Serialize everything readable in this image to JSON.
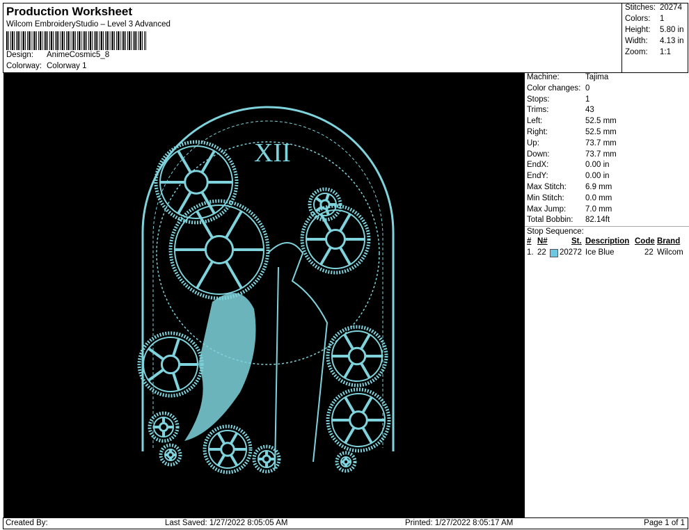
{
  "header": {
    "title": "Production Worksheet",
    "subtitle": "Wilcom EmbroideryStudio – Level 3 Advanced",
    "design_label": "Design:",
    "design": "AnimeCosmic5_8",
    "colorway_label": "Colorway:",
    "colorway": "Colorway 1"
  },
  "stats": [
    {
      "k": "Stitches:",
      "v": "20274"
    },
    {
      "k": "Colors:",
      "v": "1"
    },
    {
      "k": "Height:",
      "v": "5.80 in"
    },
    {
      "k": "Width:",
      "v": "4.13 in"
    },
    {
      "k": "Zoom:",
      "v": "1:1"
    }
  ],
  "info": [
    {
      "k": "Machine:",
      "v": "Tajima"
    },
    {
      "k": "Color changes:",
      "v": "0"
    },
    {
      "k": "Stops:",
      "v": "1"
    },
    {
      "k": "Trims:",
      "v": "43"
    },
    {
      "k": "Left:",
      "v": "52.5 mm"
    },
    {
      "k": "Right:",
      "v": "52.5 mm"
    },
    {
      "k": "Up:",
      "v": "73.7 mm"
    },
    {
      "k": "Down:",
      "v": "73.7 mm"
    },
    {
      "k": "EndX:",
      "v": "0.00 in"
    },
    {
      "k": "EndY:",
      "v": "0.00 in"
    },
    {
      "k": "Max Stitch:",
      "v": "6.9 mm"
    },
    {
      "k": "Min Stitch:",
      "v": "0.0 mm"
    },
    {
      "k": "Max Jump:",
      "v": "7.0 mm"
    },
    {
      "k": "Total Bobbin:",
      "v": "82.14ft"
    }
  ],
  "stop_sequence": {
    "label": "Stop Sequence:",
    "headers": {
      "num": "#",
      "n": "N#",
      "st": "St.",
      "desc": "Description",
      "code": "Code",
      "brand": "Brand"
    },
    "rows": [
      {
        "num": "1.",
        "n": "22",
        "color": "#6ec7e0",
        "st": "20272",
        "desc": "Ice Blue",
        "code": "22",
        "brand": "Wilcom"
      }
    ]
  },
  "footer": {
    "created": "Created By:",
    "saved": "Last Saved: 1/27/2022 8:05:05 AM",
    "printed": "Printed: 1/27/2022 8:05:17 AM",
    "page": "Page 1 of 1"
  },
  "thread_color": "#7fd3dc"
}
